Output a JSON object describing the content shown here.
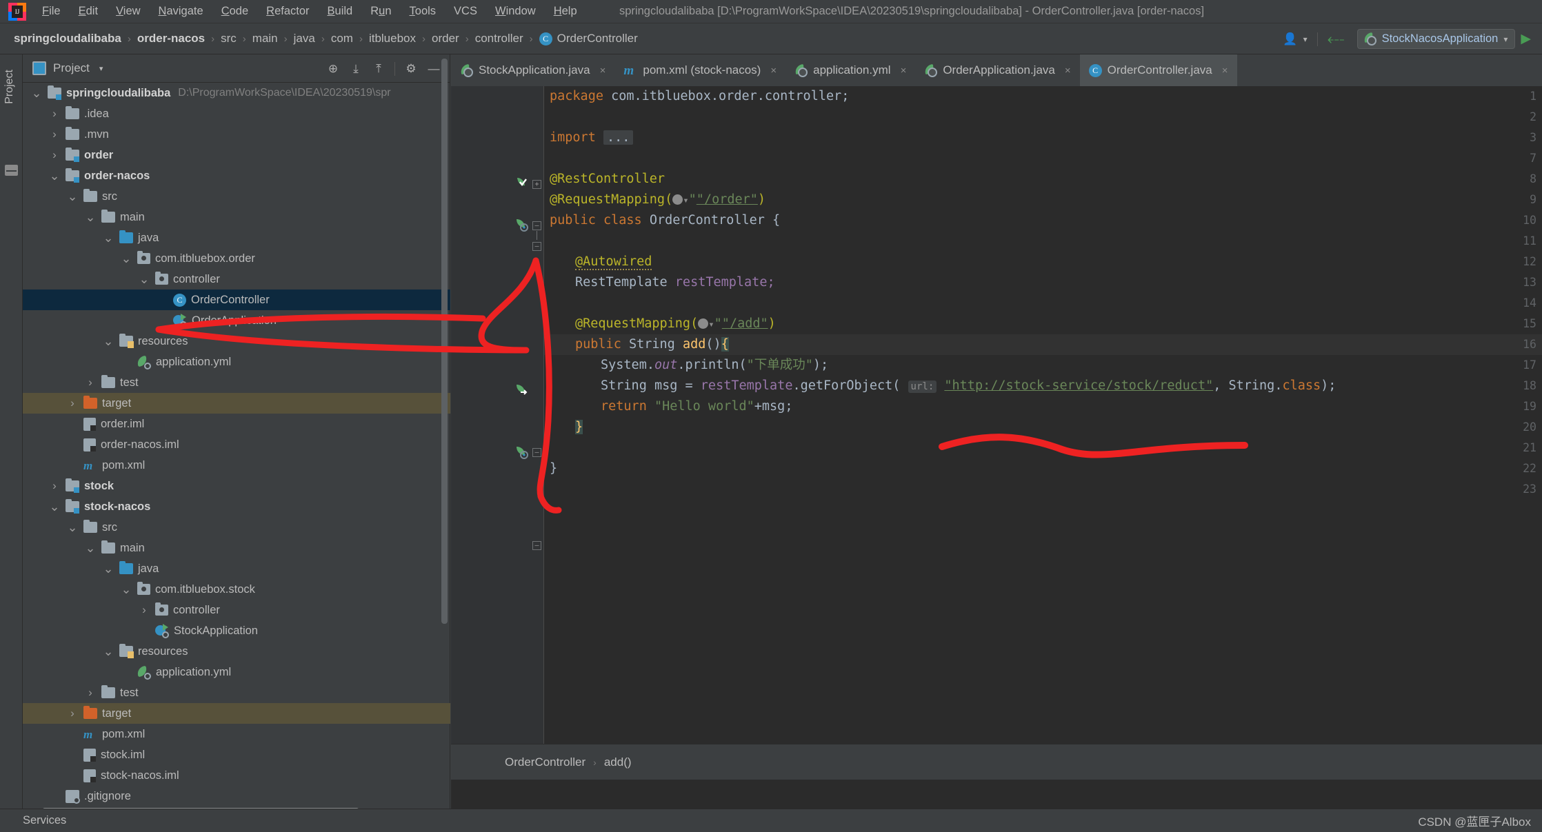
{
  "window": {
    "title": "springcloudalibaba [D:\\ProgramWorkSpace\\IDEA\\20230519\\springcloudalibaba] - OrderController.java [order-nacos]",
    "app_icon": "intellij-idea-logo",
    "logo_text": "IJ"
  },
  "menubar": {
    "items": [
      {
        "label": "File",
        "mnemonic": "F"
      },
      {
        "label": "Edit",
        "mnemonic": "E"
      },
      {
        "label": "View",
        "mnemonic": "V"
      },
      {
        "label": "Navigate",
        "mnemonic": "N"
      },
      {
        "label": "Code",
        "mnemonic": "C"
      },
      {
        "label": "Refactor",
        "mnemonic": "R"
      },
      {
        "label": "Build",
        "mnemonic": "B"
      },
      {
        "label": "Run",
        "mnemonic": "u"
      },
      {
        "label": "Tools",
        "mnemonic": "T"
      },
      {
        "label": "VCS",
        "mnemonic": ""
      },
      {
        "label": "Window",
        "mnemonic": "W"
      },
      {
        "label": "Help",
        "mnemonic": "H"
      }
    ]
  },
  "breadcrumb": {
    "items": [
      "springcloudalibaba",
      "order-nacos",
      "src",
      "main",
      "java",
      "com",
      "itbluebox",
      "order",
      "controller",
      "OrderController"
    ],
    "last_icon": "class-icon",
    "last_icon_letter": "C",
    "separator": "›"
  },
  "navbar_right": {
    "account_icon": "user-account-icon",
    "account_caret": "▾",
    "build_icon": "hammer-icon",
    "run_config_name": "StockNacosApplication",
    "run_config_icon": "spring-boot-icon",
    "run_config_caret": "▾",
    "run_icon": "run-play-icon"
  },
  "left_strip": {
    "label": "Project",
    "structure_icon": "structure-icon"
  },
  "project_panel": {
    "title": "Project",
    "title_caret": "▾",
    "panel_icon": "project-view-icon",
    "tools": [
      {
        "name": "locate-icon",
        "glyph": "⊕"
      },
      {
        "name": "expand-all-icon",
        "glyph": "⤓"
      },
      {
        "name": "collapse-all-icon",
        "glyph": "⤒"
      },
      {
        "name": "settings-gear-icon",
        "glyph": "⚙"
      },
      {
        "name": "hide-panel-icon",
        "glyph": "—"
      }
    ],
    "tree": [
      {
        "depth": 0,
        "label": "springcloudalibaba",
        "path": "D:\\ProgramWorkSpace\\IDEA\\20230519\\spr",
        "icon": "module-icon",
        "arrow": "expanded",
        "bold": true
      },
      {
        "depth": 1,
        "label": ".idea",
        "icon": "folder-icon",
        "arrow": "collapsed"
      },
      {
        "depth": 1,
        "label": ".mvn",
        "icon": "folder-icon",
        "arrow": "collapsed"
      },
      {
        "depth": 1,
        "label": "order",
        "icon": "module-icon",
        "arrow": "collapsed",
        "bold": true
      },
      {
        "depth": 1,
        "label": "order-nacos",
        "icon": "module-icon",
        "arrow": "expanded",
        "bold": true
      },
      {
        "depth": 2,
        "label": "src",
        "icon": "folder-icon",
        "arrow": "expanded"
      },
      {
        "depth": 3,
        "label": "main",
        "icon": "folder-icon",
        "arrow": "expanded"
      },
      {
        "depth": 4,
        "label": "java",
        "icon": "source-folder-icon",
        "arrow": "expanded"
      },
      {
        "depth": 5,
        "label": "com.itbluebox.order",
        "icon": "package-icon",
        "arrow": "expanded"
      },
      {
        "depth": 6,
        "label": "controller",
        "icon": "package-icon",
        "arrow": "expanded"
      },
      {
        "depth": 7,
        "label": "OrderController",
        "icon": "class-icon",
        "arrow": "none",
        "selected": true
      },
      {
        "depth": 7,
        "label": "OrderApplication",
        "icon": "spring-boot-icon",
        "arrow": "none"
      },
      {
        "depth": 4,
        "label": "resources",
        "icon": "resources-folder-icon",
        "arrow": "expanded"
      },
      {
        "depth": 5,
        "label": "application.yml",
        "icon": "spring-yaml-icon",
        "arrow": "none"
      },
      {
        "depth": 3,
        "label": "test",
        "icon": "folder-icon",
        "arrow": "collapsed"
      },
      {
        "depth": 2,
        "label": "target",
        "icon": "target-folder-icon",
        "arrow": "collapsed",
        "highlight": true
      },
      {
        "depth": 2,
        "label": "order.iml",
        "icon": "iml-file-icon",
        "arrow": "none"
      },
      {
        "depth": 2,
        "label": "order-nacos.iml",
        "icon": "iml-file-icon",
        "arrow": "none"
      },
      {
        "depth": 2,
        "label": "pom.xml",
        "icon": "maven-icon",
        "arrow": "none"
      },
      {
        "depth": 1,
        "label": "stock",
        "icon": "module-icon",
        "arrow": "collapsed",
        "bold": true
      },
      {
        "depth": 1,
        "label": "stock-nacos",
        "icon": "module-icon",
        "arrow": "expanded",
        "bold": true
      },
      {
        "depth": 2,
        "label": "src",
        "icon": "folder-icon",
        "arrow": "expanded"
      },
      {
        "depth": 3,
        "label": "main",
        "icon": "folder-icon",
        "arrow": "expanded"
      },
      {
        "depth": 4,
        "label": "java",
        "icon": "source-folder-icon",
        "arrow": "expanded"
      },
      {
        "depth": 5,
        "label": "com.itbluebox.stock",
        "icon": "package-icon",
        "arrow": "expanded"
      },
      {
        "depth": 6,
        "label": "controller",
        "icon": "package-icon",
        "arrow": "collapsed"
      },
      {
        "depth": 6,
        "label": "StockApplication",
        "icon": "spring-boot-icon",
        "arrow": "none"
      },
      {
        "depth": 4,
        "label": "resources",
        "icon": "resources-folder-icon",
        "arrow": "expanded"
      },
      {
        "depth": 5,
        "label": "application.yml",
        "icon": "spring-yaml-icon",
        "arrow": "none"
      },
      {
        "depth": 3,
        "label": "test",
        "icon": "folder-icon",
        "arrow": "collapsed"
      },
      {
        "depth": 2,
        "label": "target",
        "icon": "target-folder-icon",
        "arrow": "collapsed",
        "highlight": true
      },
      {
        "depth": 2,
        "label": "pom.xml",
        "icon": "maven-icon",
        "arrow": "none"
      },
      {
        "depth": 2,
        "label": "stock.iml",
        "icon": "iml-file-icon",
        "arrow": "none"
      },
      {
        "depth": 2,
        "label": "stock-nacos.iml",
        "icon": "iml-file-icon",
        "arrow": "none"
      },
      {
        "depth": 1,
        "label": ".gitignore",
        "icon": "gitignore-icon",
        "arrow": "none"
      }
    ]
  },
  "editor": {
    "tabs": [
      {
        "label": "StockApplication.java",
        "icon": "spring-boot-icon",
        "active": false,
        "close": "×"
      },
      {
        "label": "pom.xml (stock-nacos)",
        "icon": "maven-icon",
        "active": false,
        "close": "×"
      },
      {
        "label": "application.yml",
        "icon": "spring-yaml-icon",
        "active": false,
        "close": "×"
      },
      {
        "label": "OrderApplication.java",
        "icon": "spring-boot-icon",
        "active": false,
        "close": "×"
      },
      {
        "label": "OrderController.java",
        "icon": "class-icon",
        "active": true,
        "close": "×"
      }
    ],
    "line_numbers": [
      1,
      2,
      3,
      7,
      8,
      9,
      10,
      11,
      12,
      13,
      14,
      15,
      16,
      17,
      18,
      19,
      20,
      21,
      22,
      23
    ],
    "code": {
      "l1_package": "package",
      "l1_name": "com.itbluebox.order.controller;",
      "l3_import": "import",
      "l3_fold": "...",
      "l8_ann": "@RestController",
      "l9_ann": "@RequestMapping(",
      "l9_str": "\"/order\"",
      "l9_end": ")",
      "l10_kw1": "public",
      "l10_kw2": "class",
      "l10_name": "OrderController",
      "l10_brace": "{",
      "l12_ann": "@Autowired",
      "l13_type": "RestTemplate",
      "l13_var": "restTemplate;",
      "l15_ann": "@RequestMapping(",
      "l15_str": "\"/add\"",
      "l15_end": ")",
      "l16": "public String add(){",
      "l16_kw": "public",
      "l16_type": "String",
      "l16_mth": "add",
      "l16_paren": "()",
      "l16_brace": "{",
      "l17_sys": "System.",
      "l17_out": "out",
      "l17_println": ".println(",
      "l17_str": "\"下单成功\"",
      "l17_end": ");",
      "l18_type": "String",
      "l18_var": " msg = ",
      "l18_obj": "restTemplate",
      "l18_call": ".getForObject(",
      "l18_hint": "url:",
      "l18_url": "\"http://stock-service/stock/reduct\"",
      "l18_rest": ", String.",
      "l18_class": "class",
      "l18_end": ");",
      "l19_ret": "return",
      "l19_str": "\"Hello world\"",
      "l19_plus": "+msg;",
      "l20_brace": "}",
      "l22_brace": "}"
    },
    "bottom_breadcrumb": [
      "OrderController",
      "add()"
    ],
    "bottom_breadcrumb_sep": "›"
  },
  "statusbar": {
    "services_label": "Services",
    "watermark": "CSDN @蓝匣子Albox"
  },
  "colors": {
    "accent": "#3592c4",
    "annotation_red": "#ee2222",
    "selection_blue": "#0d293e",
    "target_highlight": "#57513a",
    "editor_bg": "#2b2b2b",
    "panel_bg": "#3c3f41"
  }
}
